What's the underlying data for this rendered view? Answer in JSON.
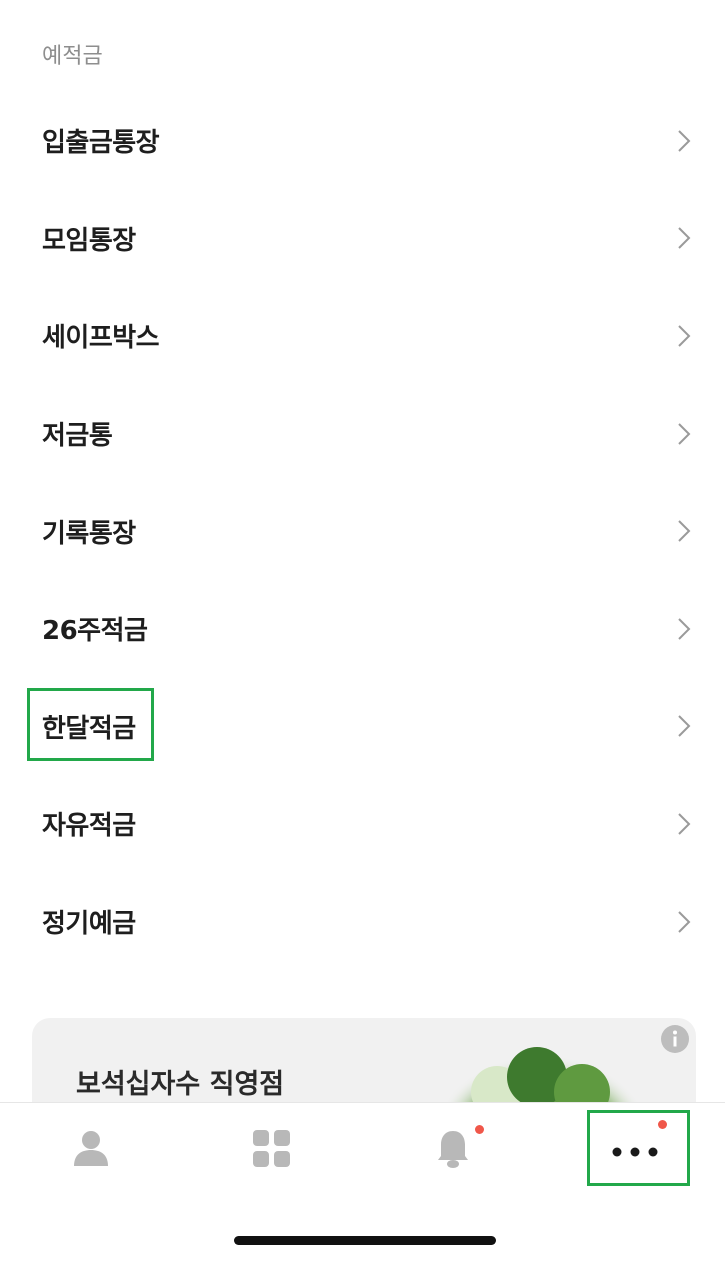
{
  "section": {
    "title": "예적금"
  },
  "menu": {
    "items": [
      {
        "label": "입출금통장"
      },
      {
        "label": "모임통장"
      },
      {
        "label": "세이프박스"
      },
      {
        "label": "저금통"
      },
      {
        "label": "기록통장"
      },
      {
        "label": "26주적금"
      },
      {
        "label": "한달적금"
      },
      {
        "label": "자유적금"
      },
      {
        "label": "정기예금"
      }
    ]
  },
  "banner": {
    "title": "보석십자수 직영점",
    "info_icon": "info-icon"
  },
  "bottom_nav": {
    "items": [
      {
        "icon": "person-icon",
        "badge": false
      },
      {
        "icon": "grid-icon",
        "badge": false
      },
      {
        "icon": "bell-icon",
        "badge": true
      },
      {
        "icon": "more-dots-icon",
        "badge": true
      }
    ]
  },
  "colors": {
    "highlight": "#22a84a",
    "badge": "#f0574a",
    "icon_gray": "#b8b8b8"
  }
}
